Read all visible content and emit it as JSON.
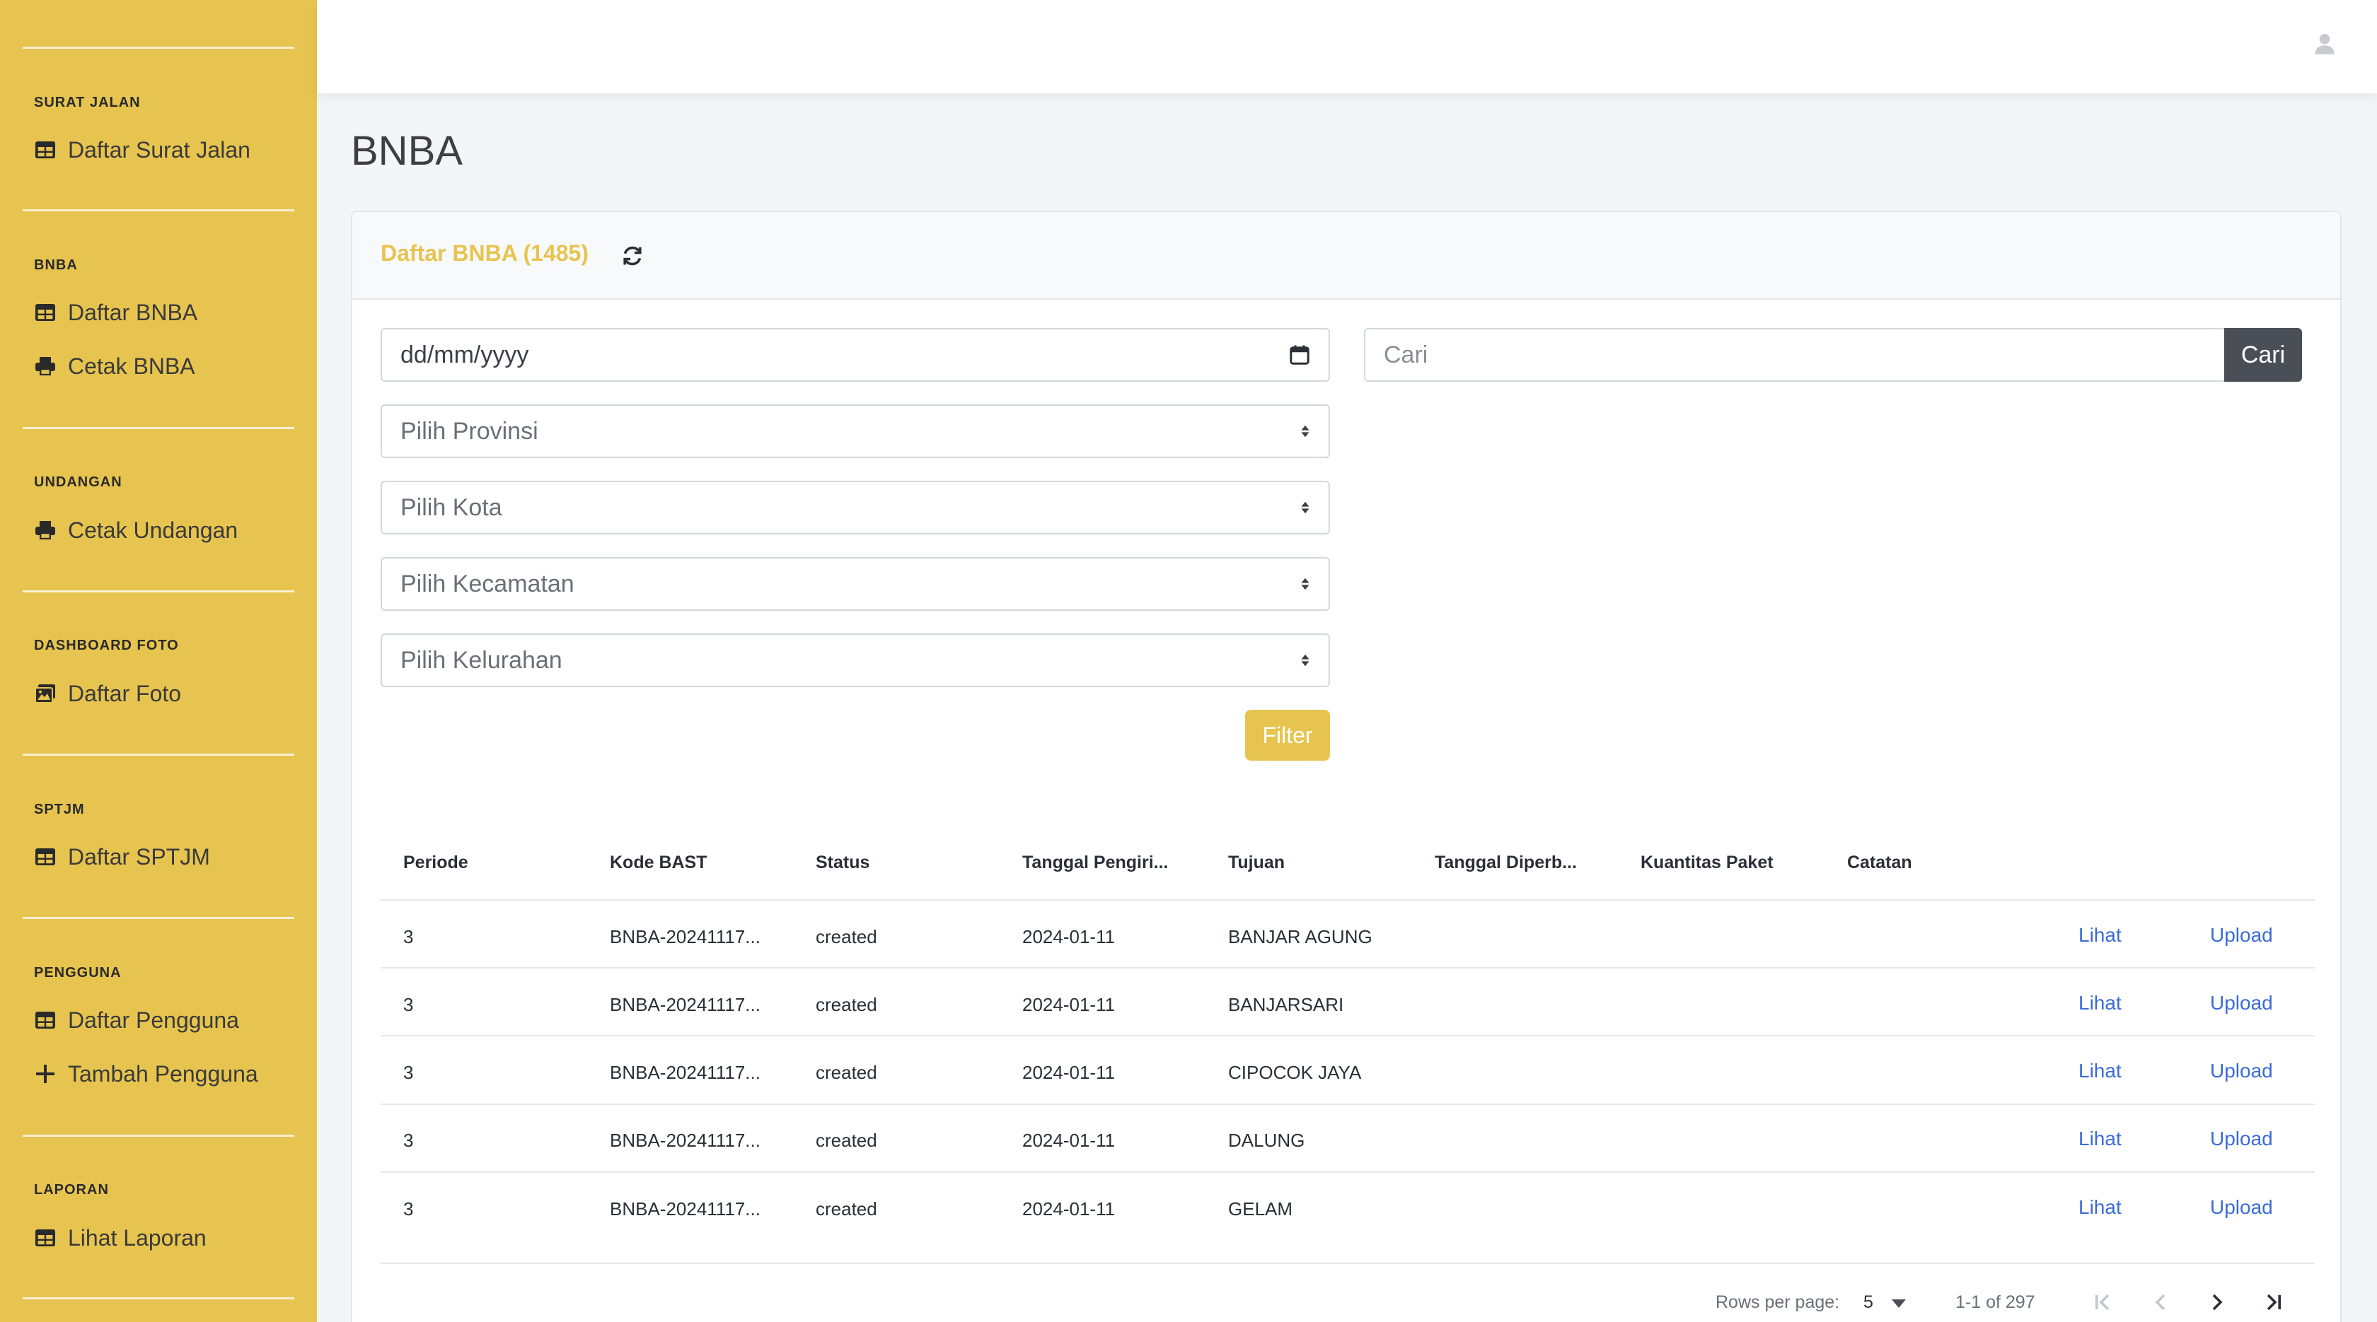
{
  "sidebar": {
    "sections": [
      {
        "heading": "SURAT JALAN",
        "items": [
          {
            "label": "Daftar Surat Jalan",
            "icon": "table-icon"
          }
        ]
      },
      {
        "heading": "BNBA",
        "items": [
          {
            "label": "Daftar BNBA",
            "icon": "table-icon"
          },
          {
            "label": "Cetak BNBA",
            "icon": "print-icon"
          }
        ]
      },
      {
        "heading": "UNDANGAN",
        "items": [
          {
            "label": "Cetak Undangan",
            "icon": "print-icon"
          }
        ]
      },
      {
        "heading": "DASHBOARD FOTO",
        "items": [
          {
            "label": "Daftar Foto",
            "icon": "images-icon"
          }
        ]
      },
      {
        "heading": "SPTJM",
        "items": [
          {
            "label": "Daftar SPTJM",
            "icon": "table-icon"
          }
        ]
      },
      {
        "heading": "PENGGUNA",
        "items": [
          {
            "label": "Daftar Pengguna",
            "icon": "table-icon"
          },
          {
            "label": "Tambah Pengguna",
            "icon": "plus-icon"
          }
        ]
      },
      {
        "heading": "LAPORAN",
        "items": [
          {
            "label": "Lihat Laporan",
            "icon": "table-icon"
          }
        ]
      }
    ]
  },
  "page": {
    "title": "BNBA"
  },
  "card": {
    "title": "Daftar BNBA (1485)"
  },
  "filters": {
    "date_placeholder": "dd/mm/yyyy",
    "provinsi": "Pilih Provinsi",
    "kota": "Pilih Kota",
    "kecamatan": "Pilih Kecamatan",
    "kelurahan": "Pilih Kelurahan",
    "filter_label": "Filter",
    "search_placeholder": "Cari",
    "search_button": "Cari"
  },
  "table": {
    "columns": [
      "Periode",
      "Kode BAST",
      "Status",
      "Tanggal Pengiri...",
      "Tujuan",
      "Tanggal Diperb...",
      "Kuantitas Paket",
      "Catatan"
    ],
    "rows": [
      {
        "periode": "3",
        "kode": "BNBA-20241117...",
        "status": "created",
        "tanggal": "2024-01-11",
        "tujuan": "BANJAR AGUNG",
        "view": "Lihat",
        "upload": "Upload"
      },
      {
        "periode": "3",
        "kode": "BNBA-20241117...",
        "status": "created",
        "tanggal": "2024-01-11",
        "tujuan": "BANJARSARI",
        "view": "Lihat",
        "upload": "Upload"
      },
      {
        "periode": "3",
        "kode": "BNBA-20241117...",
        "status": "created",
        "tanggal": "2024-01-11",
        "tujuan": "CIPOCOK JAYA",
        "view": "Lihat",
        "upload": "Upload"
      },
      {
        "periode": "3",
        "kode": "BNBA-20241117...",
        "status": "created",
        "tanggal": "2024-01-11",
        "tujuan": "DALUNG",
        "view": "Lihat",
        "upload": "Upload"
      },
      {
        "periode": "3",
        "kode": "BNBA-20241117...",
        "status": "created",
        "tanggal": "2024-01-11",
        "tujuan": "GELAM",
        "view": "Lihat",
        "upload": "Upload"
      }
    ]
  },
  "pagination": {
    "rows_per_page_label": "Rows per page:",
    "rows_per_page_value": "5",
    "range": "1-1 of 297"
  },
  "colors": {
    "accent": "#e6c44f",
    "link": "#3a6bd8",
    "dark_button": "#4a4e57"
  }
}
